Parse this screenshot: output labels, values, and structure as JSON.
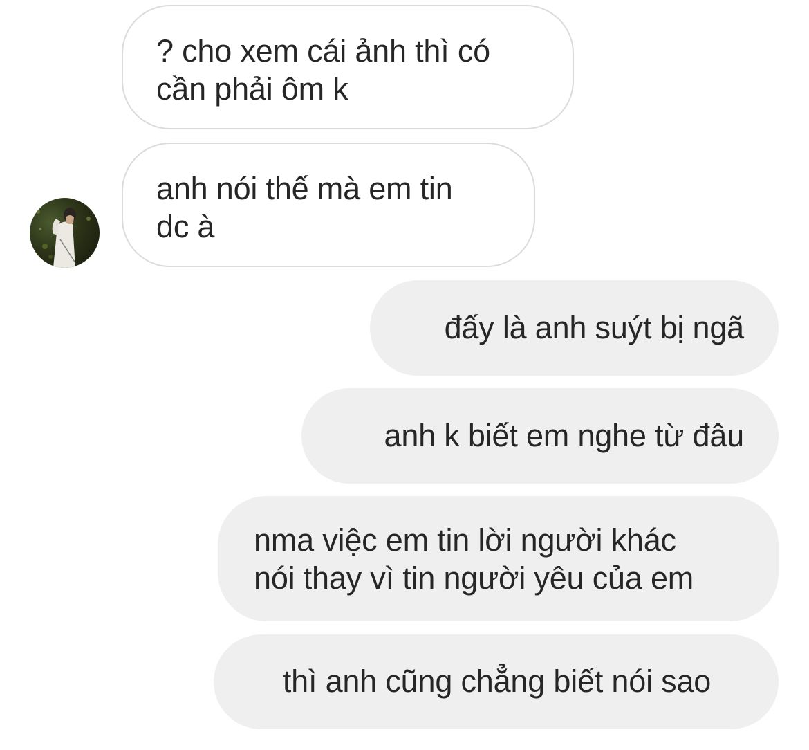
{
  "conversation": {
    "messages": [
      {
        "direction": "incoming",
        "lines": [
          "? cho xem cái ảnh thì có",
          "cần phải ôm k"
        ]
      },
      {
        "direction": "incoming",
        "lines": [
          "anh nói thế mà em tin",
          "dc à"
        ],
        "avatar": "profile-photo"
      },
      {
        "direction": "outgoing",
        "lines": [
          "đấy là anh suýt bị ngã"
        ]
      },
      {
        "direction": "outgoing",
        "lines": [
          "anh k biết em nghe từ đâu"
        ]
      },
      {
        "direction": "outgoing",
        "lines": [
          "nma việc em tin lời người khác",
          "nói thay vì tin người yêu của em"
        ]
      },
      {
        "direction": "outgoing",
        "lines": [
          "thì anh cũng chẳng biết nói sao"
        ]
      }
    ]
  },
  "colors": {
    "incoming_bubble_bg": "#ffffff",
    "incoming_bubble_border": "#dbdbdb",
    "outgoing_bubble_bg": "#efefef",
    "text": "#262626"
  }
}
